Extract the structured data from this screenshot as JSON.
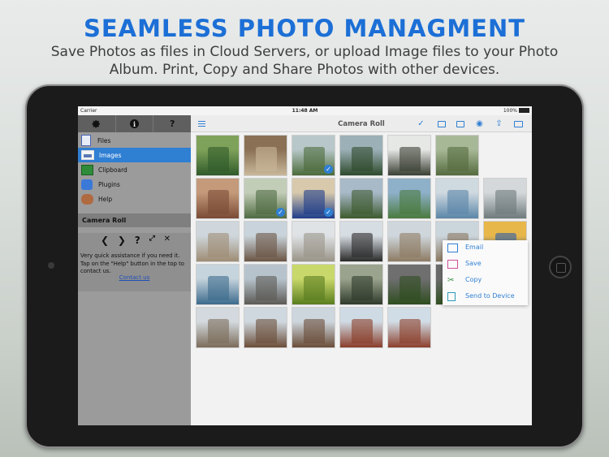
{
  "headline": "SEAMLESS PHOTO MANAGMENT",
  "subline": "Save Photos as files in Cloud Servers, or upload Image files to your Photo Album. Print, Copy and Share Photos with other devices.",
  "statusbar": {
    "carrier": "Carrier",
    "time": "11:48 AM",
    "battery": "100%"
  },
  "sidebar": {
    "toolbar": {
      "settings_icon": "gear-icon",
      "info_icon": "info-icon",
      "help_label": "?"
    },
    "items": [
      {
        "label": "Files",
        "icon": "files-icon"
      },
      {
        "label": "Images",
        "icon": "images-icon",
        "active": true
      },
      {
        "label": "Clipboard",
        "icon": "clipboard-icon"
      },
      {
        "label": "Plugins",
        "icon": "plugins-icon"
      },
      {
        "label": "Help",
        "icon": "help-icon"
      }
    ],
    "section_title": "Camera Roll",
    "help": {
      "back": "❮",
      "forward": "❯",
      "question": "?",
      "expand": "⤢",
      "close": "✕",
      "text": "Very quick assistance if you need it. Tap on the \"Help\" button in the top to contact us.",
      "link": "Contact us"
    }
  },
  "main": {
    "title": "Camera Roll",
    "toolbar_icons": [
      "menu-icon",
      "checkmark-icon",
      "camera-icon",
      "folder-icon",
      "eye-icon",
      "share-icon",
      "print-icon"
    ]
  },
  "popup": {
    "items": [
      {
        "label": "Email",
        "icon": "email-icon"
      },
      {
        "label": "Save",
        "icon": "save-icon"
      },
      {
        "label": "Copy",
        "icon": "copy-icon"
      },
      {
        "label": "Send to Device",
        "icon": "send-to-device-icon"
      }
    ]
  },
  "photos": [
    {
      "row": 0,
      "col": 0,
      "subject": "hobbit-house",
      "c1": "#2f5a2a",
      "c2": "#7fa25a",
      "checked": false
    },
    {
      "row": 0,
      "col": 1,
      "subject": "insect-on-sand",
      "c1": "#c9b79a",
      "c2": "#8a7155",
      "checked": false
    },
    {
      "row": 0,
      "col": 2,
      "subject": "waterfall",
      "c1": "#4b6b3a",
      "c2": "#b8c7c9",
      "checked": true
    },
    {
      "row": 0,
      "col": 3,
      "subject": "valley-waterfall",
      "c1": "#2e4a2c",
      "c2": "#9bb0b7",
      "checked": false
    },
    {
      "row": 0,
      "col": 4,
      "subject": "cascade",
      "c1": "#3a3f33",
      "c2": "#e6e8e6",
      "checked": false
    },
    {
      "row": 0,
      "col": 5,
      "subject": "landscape",
      "c1": "#556b3e",
      "c2": "#a7b897",
      "checked": false
    },
    {
      "row": 1,
      "col": 0,
      "subject": "cliff-coast",
      "c1": "#7a4b35",
      "c2": "#c49a7a",
      "checked": false
    },
    {
      "row": 1,
      "col": 1,
      "subject": "garden-plants",
      "c1": "#4f6b42",
      "c2": "#c2cdb7",
      "checked": true
    },
    {
      "row": 1,
      "col": 2,
      "subject": "clock-tower",
      "c1": "#1f3d8a",
      "c2": "#d8c9ac",
      "checked": true
    },
    {
      "row": 1,
      "col": 3,
      "subject": "mountain-valley",
      "c1": "#3d5a2e",
      "c2": "#a8b9c8",
      "checked": false
    },
    {
      "row": 1,
      "col": 4,
      "subject": "temple-lake",
      "c1": "#4a7a3e",
      "c2": "#8fb0c9",
      "checked": false
    },
    {
      "row": 1,
      "col": 5,
      "subject": "lake",
      "c1": "#5a86a8",
      "c2": "#cfd9e0",
      "checked": false
    },
    {
      "row": 1,
      "col": 6,
      "subject": "building",
      "c1": "#6e7a7c",
      "c2": "#d4d8da",
      "checked": false
    },
    {
      "row": 2,
      "col": 0,
      "subject": "church-tower",
      "c1": "#9e8c74",
      "c2": "#cfd7dc",
      "checked": false
    },
    {
      "row": 2,
      "col": 1,
      "subject": "eiffel-tower",
      "c1": "#6a5544",
      "c2": "#c9d3db",
      "checked": false
    },
    {
      "row": 2,
      "col": 2,
      "subject": "palace",
      "c1": "#9a9488",
      "c2": "#dfe3e6",
      "checked": false
    },
    {
      "row": 2,
      "col": 3,
      "subject": "horse-statue",
      "c1": "#2a2a2a",
      "c2": "#d6dde3",
      "checked": false
    },
    {
      "row": 2,
      "col": 4,
      "subject": "arch-monument",
      "c1": "#8d7b63",
      "c2": "#cfd7dd",
      "checked": false
    },
    {
      "row": 2,
      "col": 5,
      "subject": "arch-monument",
      "c1": "#8a7860",
      "c2": "#cbd5dc",
      "checked": false
    },
    {
      "row": 2,
      "col": 6,
      "subject": "carousel",
      "c1": "#2d5ea8",
      "c2": "#e8b74a",
      "checked": false
    },
    {
      "row": 3,
      "col": 0,
      "subject": "harbor",
      "c1": "#3c6a8c",
      "c2": "#c6d4dd",
      "checked": false
    },
    {
      "row": 3,
      "col": 1,
      "subject": "pier",
      "c1": "#5c5a55",
      "c2": "#b7c3cc",
      "checked": false
    },
    {
      "row": 3,
      "col": 2,
      "subject": "green-leaves",
      "c1": "#5a7d1f",
      "c2": "#c9d86a",
      "checked": false
    },
    {
      "row": 3,
      "col": 3,
      "subject": "birdhouse",
      "c1": "#2f3a2b",
      "c2": "#9aa38d",
      "checked": false
    },
    {
      "row": 3,
      "col": 4,
      "subject": "cow",
      "c1": "#2e4d1f",
      "c2": "#6f6f6f",
      "checked": false
    },
    {
      "row": 3,
      "col": 5,
      "subject": "cow",
      "c1": "#305021",
      "c2": "#6b6b6b",
      "checked": false
    },
    {
      "row": 3,
      "col": 6,
      "subject": "cathedral",
      "c1": "#7c6e5e",
      "c2": "#cfd6dc",
      "checked": false
    },
    {
      "row": 4,
      "col": 0,
      "subject": "cathedral",
      "c1": "#7b6c5a",
      "c2": "#d3d9de",
      "checked": false
    },
    {
      "row": 4,
      "col": 1,
      "subject": "palace-facade",
      "c1": "#6b4e3a",
      "c2": "#cfd8df",
      "checked": false
    },
    {
      "row": 4,
      "col": 2,
      "subject": "palace-facade",
      "c1": "#6a4d39",
      "c2": "#cdd6dd",
      "checked": false
    },
    {
      "row": 4,
      "col": 3,
      "subject": "royal-albert-hall",
      "c1": "#8a3d2a",
      "c2": "#cfdbe4",
      "checked": false
    },
    {
      "row": 4,
      "col": 4,
      "subject": "royal-albert-hall",
      "c1": "#8c3f2c",
      "c2": "#d1dde6",
      "checked": false
    }
  ]
}
